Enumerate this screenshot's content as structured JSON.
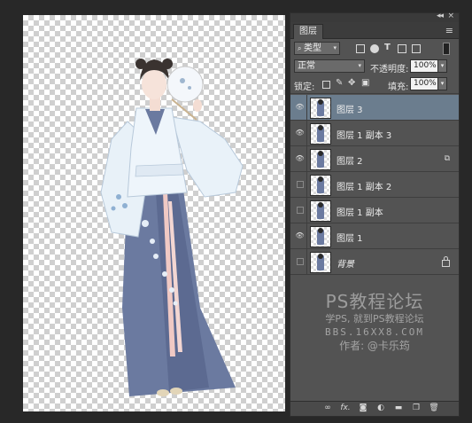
{
  "panel": {
    "tab_label": "图层",
    "filter": {
      "label": "类型"
    },
    "blend_mode": "正常",
    "opacity_label": "不透明度:",
    "opacity_value": "100%",
    "lock_label": "锁定:",
    "fill_label": "填充:",
    "fill_value": "100%",
    "layers": [
      {
        "name": "图层 3",
        "visible": true,
        "selected": true,
        "badge": ""
      },
      {
        "name": "图层 1 副本 3",
        "visible": true,
        "selected": false,
        "badge": ""
      },
      {
        "name": "图层 2",
        "visible": true,
        "selected": false,
        "badge": "⧉"
      },
      {
        "name": "图层 1 副本 2",
        "visible": false,
        "selected": false,
        "badge": ""
      },
      {
        "name": "图层 1 副本",
        "visible": false,
        "selected": false,
        "badge": ""
      },
      {
        "name": "图层 1",
        "visible": true,
        "selected": false,
        "badge": ""
      },
      {
        "name": "背景",
        "visible": false,
        "selected": false,
        "badge": "lock"
      }
    ],
    "watermark": {
      "title": "PS教程论坛",
      "subtitle": "学PS, 就到PS教程论坛",
      "site": "BBS.16XX8.COM",
      "author": "作者: @卡乐筠"
    },
    "bottom_icons": [
      "link-icon",
      "fx-icon",
      "mask-icon",
      "adjustment-icon",
      "folder-icon",
      "new-layer-icon",
      "trash-icon"
    ]
  },
  "colors": {
    "panel_bg": "#535353",
    "selected_row": "#6b7d8e",
    "dress_blue": "#6b7aa0"
  }
}
